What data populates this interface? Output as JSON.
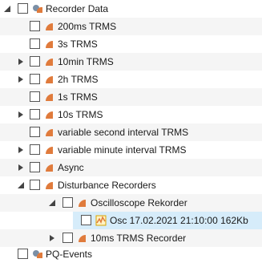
{
  "tree": {
    "root": {
      "label": "Recorder Data",
      "icon": "recorder-data-icon"
    },
    "items": [
      {
        "label": "200ms TRMS",
        "icon": "recorder-icon"
      },
      {
        "label": "3s TRMS",
        "icon": "recorder-icon"
      },
      {
        "label": "10min TRMS",
        "icon": "recorder-icon"
      },
      {
        "label": "2h TRMS",
        "icon": "recorder-icon"
      },
      {
        "label": "1s TRMS",
        "icon": "recorder-icon"
      },
      {
        "label": "10s TRMS",
        "icon": "recorder-icon"
      },
      {
        "label": "variable second interval TRMS",
        "icon": "recorder-icon"
      },
      {
        "label": "variable minute interval TRMS",
        "icon": "recorder-icon"
      },
      {
        "label": "Async",
        "icon": "recorder-icon"
      },
      {
        "label": "Disturbance Recorders",
        "icon": "recorder-icon"
      }
    ],
    "disturbance": {
      "oscilloscope": {
        "label": "Oscilloscope Rekorder",
        "icon": "recorder-icon"
      },
      "osc_file": {
        "label": "Osc 17.02.2021 21:10:00 162Kb",
        "icon": "waveform-file-icon"
      },
      "ms10": {
        "label": "10ms TRMS Recorder",
        "icon": "recorder-icon"
      }
    },
    "pq_events": {
      "label": "PQ-Events",
      "icon": "pq-events-icon"
    }
  },
  "colors": {
    "selection": "#d6ecfa",
    "recorder_icon": "#e07b3c",
    "waveform_icon": "#f0b000"
  }
}
